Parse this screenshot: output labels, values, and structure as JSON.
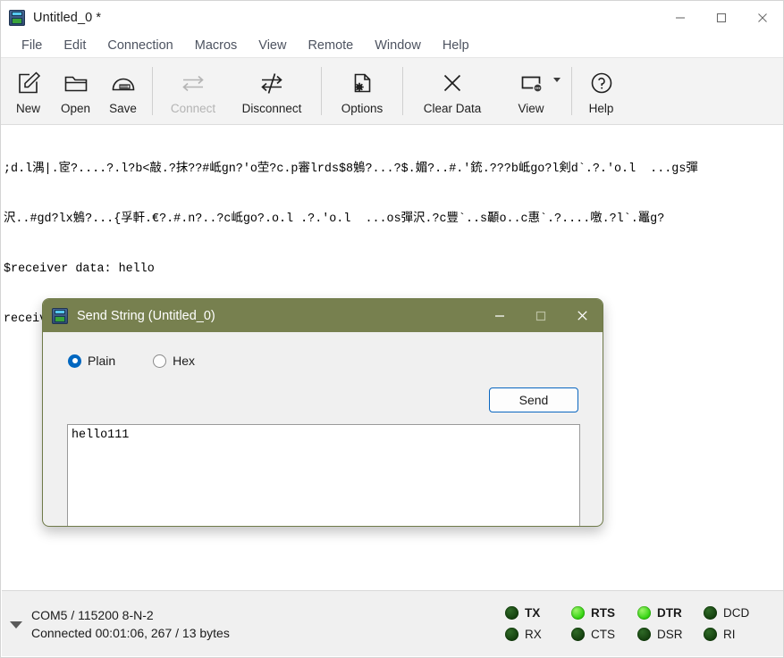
{
  "window": {
    "title": "Untitled_0 *",
    "app_icon": "serial-terminal-icon",
    "controls": {
      "minimize": "minimize-icon",
      "maximize": "maximize-icon",
      "close": "close-icon"
    }
  },
  "menubar": {
    "items": [
      {
        "label": "File"
      },
      {
        "label": "Edit"
      },
      {
        "label": "Connection"
      },
      {
        "label": "Macros"
      },
      {
        "label": "View"
      },
      {
        "label": "Remote"
      },
      {
        "label": "Window"
      },
      {
        "label": "Help"
      }
    ]
  },
  "toolbar": {
    "buttons": [
      {
        "label": "New",
        "icon": "new-document-icon",
        "disabled": false
      },
      {
        "label": "Open",
        "icon": "folder-open-icon",
        "disabled": false
      },
      {
        "label": "Save",
        "icon": "save-disk-icon",
        "disabled": false
      },
      {
        "label": "Connect",
        "icon": "connect-arrows-icon",
        "disabled": true
      },
      {
        "label": "Disconnect",
        "icon": "disconnect-icon",
        "disabled": false
      },
      {
        "label": "Options",
        "icon": "document-gear-icon",
        "disabled": false
      },
      {
        "label": "Clear Data",
        "icon": "clear-x-icon",
        "disabled": false
      },
      {
        "label": "View",
        "icon": "view-window-icon",
        "disabled": false,
        "has_dropdown": true
      },
      {
        "label": "Help",
        "icon": "help-question-icon",
        "disabled": false
      }
    ]
  },
  "terminal": {
    "lines": [
      ";d.l湡|.宧?....?.l?b<敲.?抹??#岻gn?'o茔?c.p審lrds$8鵵?...?$.媚?..#.'銃.???b岻go?l剣d`.?.'o.l  ...gs彈",
      "沢..#gd?lx鵵?...{孚軒.€?.#.n?..?c岻go?.o.l .?.'o.l  ...os彈沢.?c豐`..s顳o..c惠`.?....噭.?l`.鼉g?",
      "$receiver data: hello",
      "receiver data: hello111"
    ]
  },
  "dialog": {
    "title": "Send String (Untitled_0)",
    "icon": "serial-terminal-icon",
    "controls": {
      "minimize": "minimize-icon",
      "maximize": "maximize-icon",
      "close": "close-icon"
    },
    "format_options": [
      {
        "label": "Plain",
        "checked": true
      },
      {
        "label": "Hex",
        "checked": false
      }
    ],
    "send_button": "Send",
    "input_value": "hello111",
    "title_bar_color": "#77804F",
    "accent_color": "#0A66C0"
  },
  "statusbar": {
    "expander_icon": "chevron-down-icon",
    "port_info": "COM5 / 115200 8-N-2",
    "connection_info": "Connected 00:01:06, 267 / 13 bytes",
    "leds": [
      {
        "label": "TX",
        "on": false,
        "bold": true
      },
      {
        "label": "RTS",
        "on": true,
        "bold": true
      },
      {
        "label": "DTR",
        "on": true,
        "bold": true
      },
      {
        "label": "DCD",
        "on": false,
        "bold": false
      },
      {
        "label": "RX",
        "on": false,
        "bold": false
      },
      {
        "label": "CTS",
        "on": false,
        "bold": false
      },
      {
        "label": "DSR",
        "on": false,
        "bold": false
      },
      {
        "label": "RI",
        "on": false,
        "bold": false
      }
    ],
    "led_on_color": "#35D413",
    "led_off_color": "#1C4F14"
  }
}
